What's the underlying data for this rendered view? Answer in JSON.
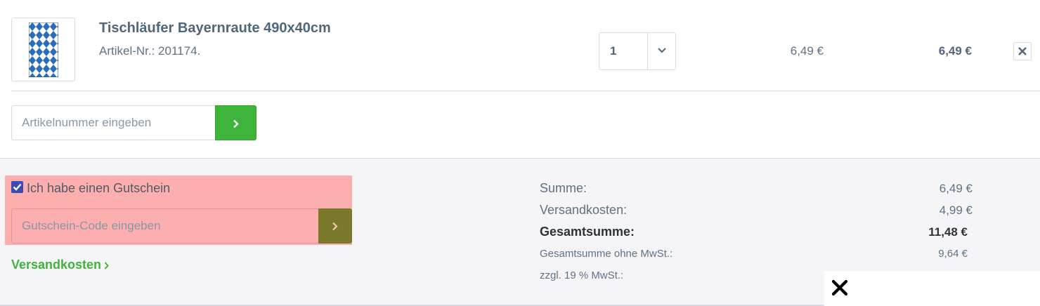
{
  "item": {
    "title": "Tischläufer Bayernraute 490x40cm",
    "sku_label": "Artikel-Nr.: 201174.",
    "quantity": "1",
    "unit_price": "6,49 €",
    "line_total": "6,49 €",
    "thumbnail_icon": "bavarian-diamond-pattern-image",
    "remove_icon": "close-icon"
  },
  "article_entry": {
    "placeholder": "Artikelnummer eingeben",
    "submit_icon": "chevron-right-icon"
  },
  "voucher": {
    "checkbox_checked": true,
    "checkbox_label": "Ich habe einen Gutschein",
    "placeholder": "Gutschein-Code eingeben",
    "submit_icon": "chevron-right-icon"
  },
  "shipping_link": {
    "label": "Versandkosten"
  },
  "summary": {
    "subtotal_label": "Summe:",
    "subtotal_value": "6,49 €",
    "shipping_label": "Versandkosten:",
    "shipping_value": "4,99 €",
    "total_label": "Gesamtsumme:",
    "total_value": "11,48 €",
    "net_label": "Gesamtsumme ohne MwSt.:",
    "net_value": "9,64 €",
    "vat_label": "zzgl. 19 % MwSt.:"
  },
  "overlay": {
    "close_icon": "close-icon"
  },
  "colors": {
    "accent_green": "#3fb43a",
    "text": "#5f7285",
    "footer_bg": "#f5f5f8",
    "highlight": "#ff9696",
    "checkbox": "#3b4ab8"
  }
}
